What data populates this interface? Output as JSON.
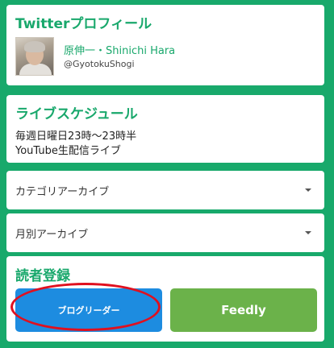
{
  "twitter": {
    "title": "Twitterプロフィール",
    "name": "原伸一・Shinichi Hara",
    "handle": "@GyotokuShogi"
  },
  "live": {
    "title": "ライブスケジュール",
    "line1": "毎週日曜日23時〜23時半",
    "line2": "YouTube生配信ライブ"
  },
  "archives": {
    "category_label": "カテゴリアーカイブ",
    "monthly_label": "月別アーカイブ"
  },
  "reader": {
    "title": "読者登録",
    "blog_button": "ブログリーダー",
    "feedly_button": "Feedly"
  },
  "colors": {
    "background": "#18a96b",
    "accent": "#19a86c",
    "blog_button": "#1d8ce0",
    "feedly_button": "#6bb24a",
    "annotation": "#e0101f"
  }
}
